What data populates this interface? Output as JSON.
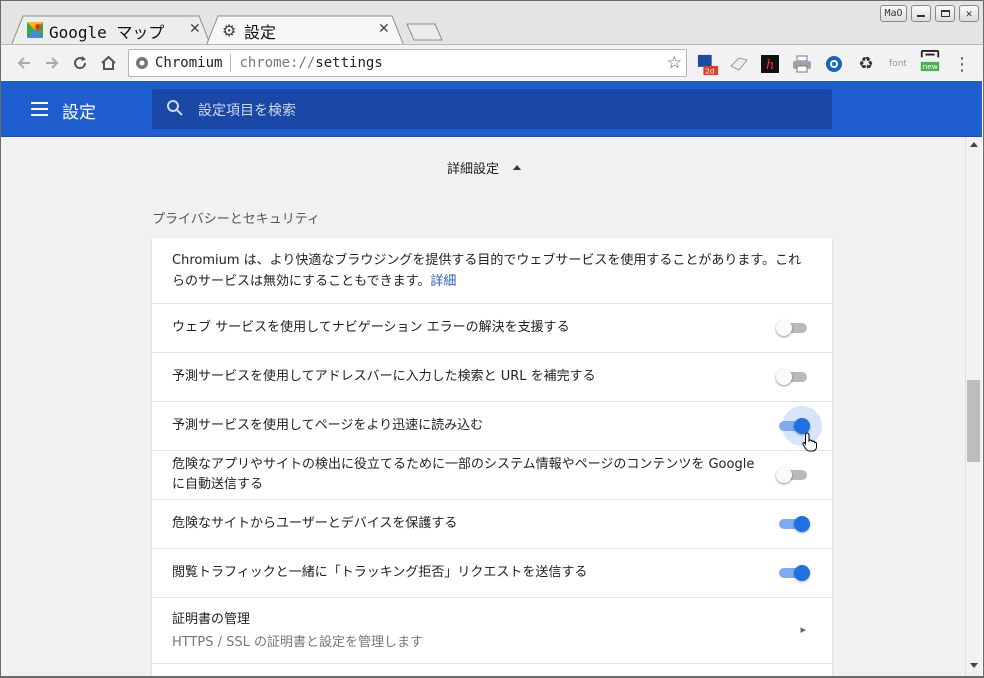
{
  "browser": {
    "tabs": [
      {
        "title": "Google マップ",
        "icon": "google-maps-icon"
      },
      {
        "title": "設定",
        "icon": "gear-icon"
      }
    ],
    "window_controls": {
      "profile_label": "MaO"
    },
    "omnibox": {
      "site": "Chromium",
      "scheme": "chrome://",
      "path": "settings"
    },
    "extensions": [
      {
        "name": "2d-extension-icon",
        "badge": "2d"
      },
      {
        "name": "tag-extension-icon"
      },
      {
        "name": "h-extension-icon",
        "label": "h"
      },
      {
        "name": "print-extension-icon"
      },
      {
        "name": "network-extension-icon"
      },
      {
        "name": "recycle-extension-icon"
      },
      {
        "name": "font-extension-icon",
        "label": "font"
      },
      {
        "name": "screenshot-extension-icon",
        "badge": "new"
      }
    ]
  },
  "header": {
    "title": "設定",
    "search_placeholder": "設定項目を検索"
  },
  "main": {
    "advanced_label": "詳細設定",
    "section_title": "プライバシーとセキュリティ",
    "intro_text": "Chromium は、より快適なブラウジングを提供する目的でウェブサービスを使用することがあります。これらのサービスは無効にすることもできます。",
    "intro_link": "詳細",
    "rows": [
      {
        "label": "ウェブ サービスを使用してナビゲーション エラーの解決を支援する",
        "enabled": false
      },
      {
        "label": "予測サービスを使用してアドレスバーに入力した検索と URL を補完する",
        "enabled": false
      },
      {
        "label": "予測サービスを使用してページをより迅速に読み込む",
        "enabled": true
      },
      {
        "label": "危険なアプリやサイトの検出に役立てるために一部のシステム情報やページのコンテンツを Google に自動送信する",
        "enabled": false
      },
      {
        "label": "危険なサイトからユーザーとデバイスを保護する",
        "enabled": true
      },
      {
        "label": "閲覧トラフィックと一緒に「トラッキング拒否」リクエストを送信する",
        "enabled": true
      }
    ],
    "certificates": {
      "title": "証明書の管理",
      "subtitle": "HTTPS / SSL の証明書と設定を管理します"
    }
  },
  "colors": {
    "accent": "#1f5ecf",
    "toggle_on": "#1f6fe5",
    "link": "#2962ca"
  }
}
